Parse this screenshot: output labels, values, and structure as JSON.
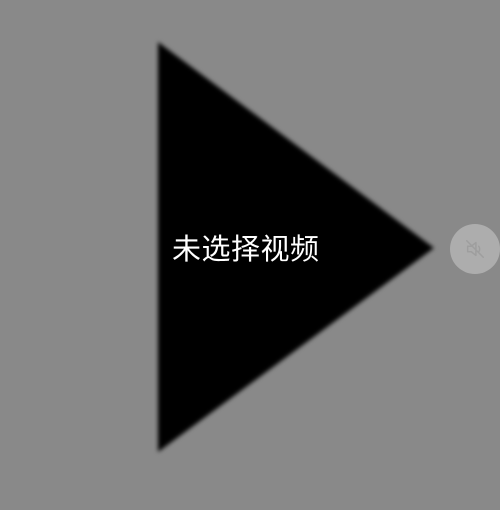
{
  "player": {
    "status_text": "未选择视频",
    "play_icon": "play-triangle-icon",
    "mute_icon": "speaker-muted-icon"
  },
  "colors": {
    "background": "#898989",
    "triangle": "#000000",
    "label": "#ffffff",
    "mute_button_bg": "#b4b4b4"
  }
}
